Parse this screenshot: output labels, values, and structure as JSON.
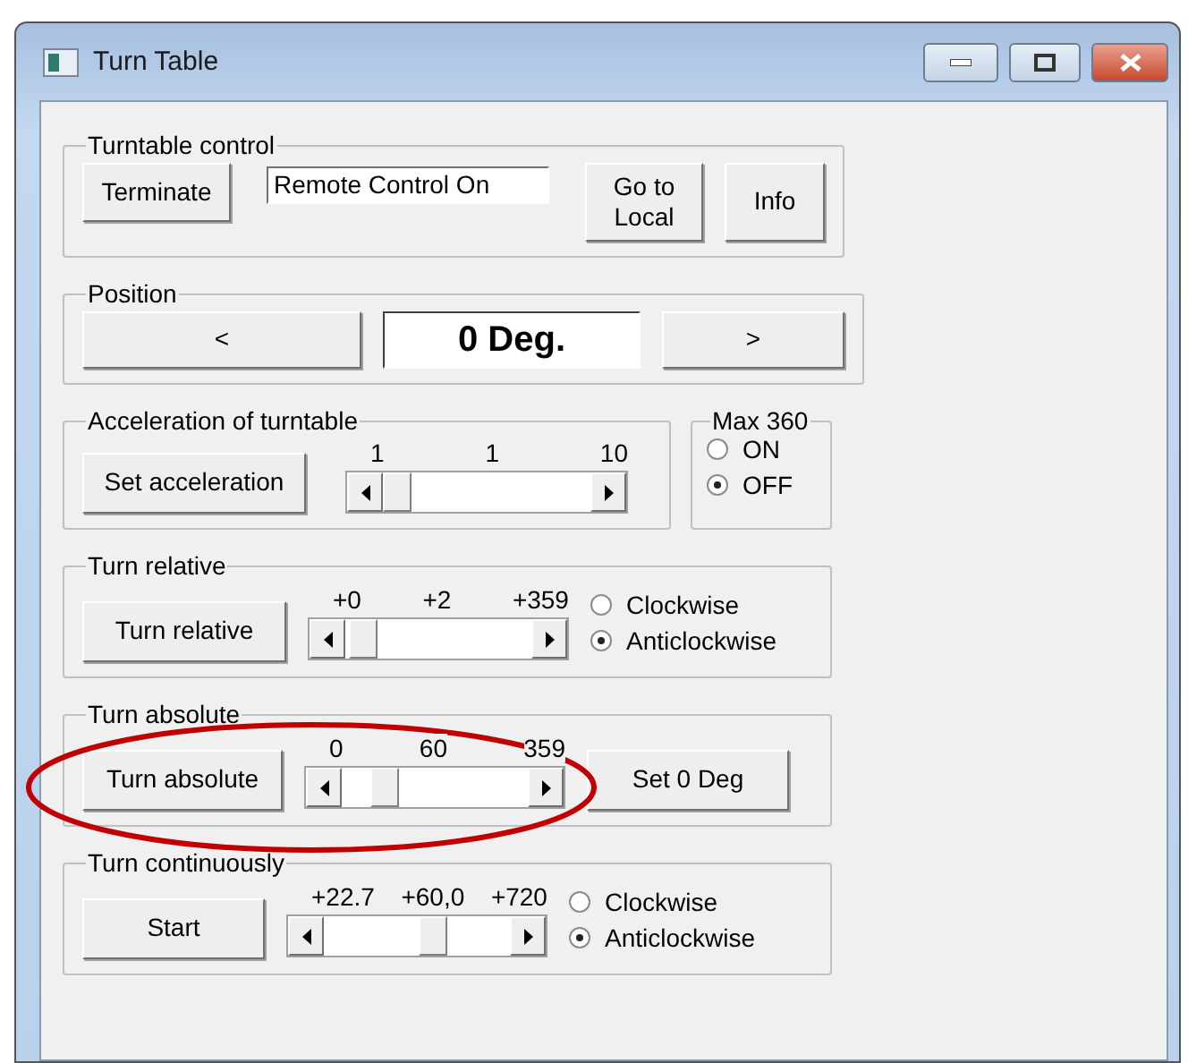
{
  "window": {
    "title": "Turn Table"
  },
  "turntable_control": {
    "title": "Turntable control",
    "terminate_button": "Terminate",
    "status": "Remote Control On",
    "go_to_local_button": "Go to Local",
    "info_button": "Info"
  },
  "position": {
    "title": "Position",
    "left_button": "<",
    "value": "0 Deg.",
    "right_button": ">"
  },
  "acceleration": {
    "title": "Acceleration of turntable",
    "button": "Set acceleration",
    "slider": {
      "min_label": "1",
      "value_label": "1",
      "max_label": "10"
    }
  },
  "max_360": {
    "title": "Max 360",
    "options": [
      {
        "label": "ON",
        "selected": false
      },
      {
        "label": "OFF",
        "selected": true
      }
    ]
  },
  "turn_relative": {
    "title": "Turn relative",
    "button": "Turn relative",
    "slider": {
      "min_label": "+0",
      "value_label": "+2",
      "max_label": "+359"
    },
    "options": [
      {
        "label": "Clockwise",
        "selected": false
      },
      {
        "label": "Anticlockwise",
        "selected": true
      }
    ]
  },
  "turn_absolute": {
    "title": "Turn absolute",
    "button": "Turn absolute",
    "slider": {
      "min_label": "0",
      "value_label": "60",
      "max_label": "359"
    },
    "set_zero_button": "Set 0 Deg"
  },
  "turn_continuously": {
    "title": "Turn continuously",
    "button": "Start",
    "slider": {
      "min_label": "+22.7",
      "value_label": "+60,0",
      "max_label": "+720"
    },
    "options": [
      {
        "label": "Clockwise",
        "selected": false
      },
      {
        "label": "Anticlockwise",
        "selected": true
      }
    ]
  }
}
